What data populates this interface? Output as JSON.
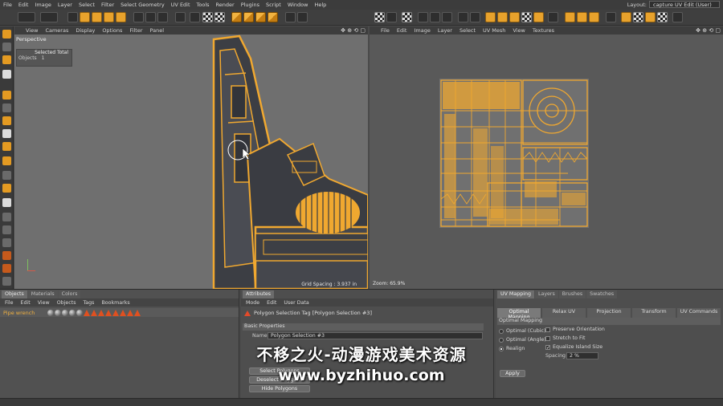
{
  "menubar": {
    "items": [
      "File",
      "Edit",
      "Image",
      "Layer",
      "Select",
      "Filter",
      "Select Geometry",
      "UV Edit",
      "Tools",
      "Render",
      "Plugins",
      "Script",
      "Window",
      "Help"
    ],
    "layout_label": "Layout:",
    "layout_value": "capture UV Edit (User)"
  },
  "viewport": {
    "menu": [
      "View",
      "Cameras",
      "Display",
      "Options",
      "Filter",
      "Panel"
    ],
    "camera": "Perspective",
    "stats_header": "Selected Total",
    "stats_label": "Objects",
    "stats_value": "1",
    "grid_spacing": "Grid Spacing : 3.937 in"
  },
  "uv_view": {
    "menu": [
      "File",
      "Edit",
      "Image",
      "Layer",
      "Select",
      "UV Mesh",
      "View",
      "Textures"
    ],
    "zoom": "Zoom: 65.9%"
  },
  "objects": {
    "tabs": [
      "Objects",
      "Materials",
      "Colors"
    ],
    "menu": [
      "File",
      "Edit",
      "View",
      "Objects",
      "Tags",
      "Bookmarks"
    ],
    "object_name": "Pipe wrench"
  },
  "attributes": {
    "tab": "Attributes",
    "menu": [
      "Mode",
      "Edit",
      "User Data"
    ],
    "title": "Polygon Selection Tag [Polygon Selection #3]",
    "section": "Basic Properties",
    "name_label": "Name",
    "name_value": "Polygon Selection #3",
    "buttons": [
      "Select Polygons",
      "Deselect Polygons",
      "Hide Polygons"
    ]
  },
  "uv_manager": {
    "tabs": [
      "UV Mapping",
      "Layers",
      "Brushes",
      "Swatches"
    ],
    "subtabs": [
      "Optimal Mapping",
      "Relax UV",
      "Projection",
      "Transform",
      "UV Commands"
    ],
    "section": "Optimal Mapping",
    "radios": [
      "Optimal (Cubic)",
      "Optimal (Angle)",
      "Realign"
    ],
    "checks": [
      "Preserve Orientation",
      "Stretch to Fit",
      "Equalize Island Size"
    ],
    "spacing_label": "Spacing",
    "spacing_value": "2 %",
    "apply": "Apply"
  },
  "watermark": {
    "line1": "不移之火-动漫游戏美术资源",
    "line2": "www.byzhihuo.com"
  },
  "colors": {
    "accent": "#f0a830",
    "viewport_bg": "#6f6f6f",
    "panel_bg": "#4a4a4a"
  }
}
